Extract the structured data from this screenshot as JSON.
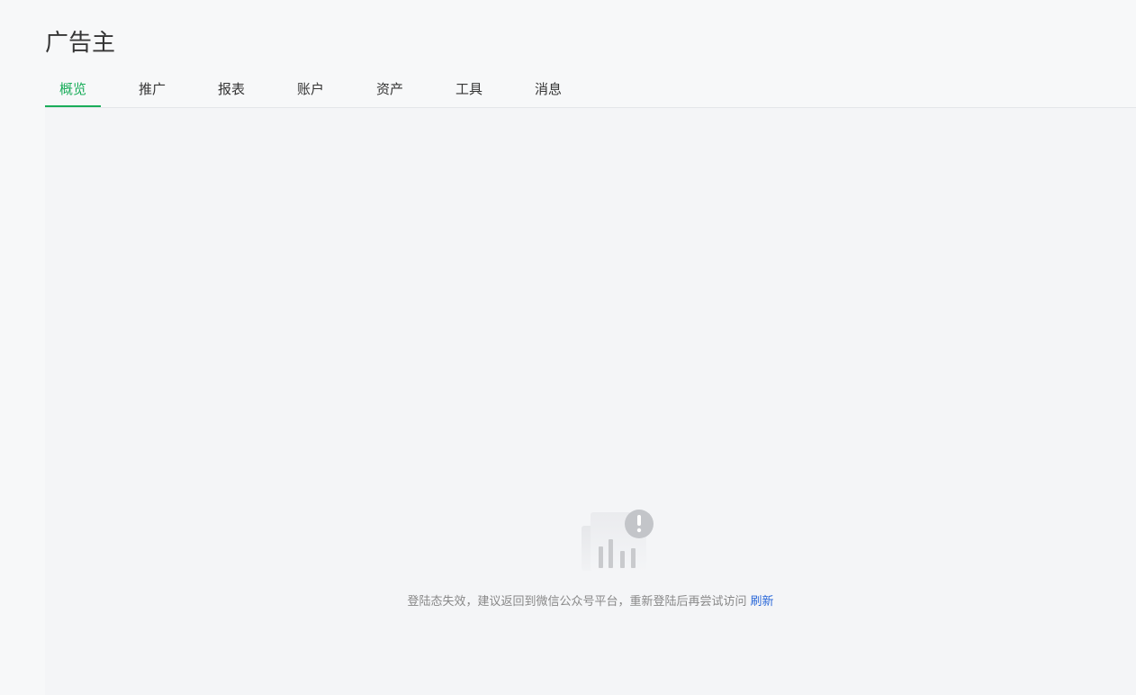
{
  "header": {
    "title": "广告主"
  },
  "tabs": [
    {
      "label": "概览",
      "active": true
    },
    {
      "label": "推广",
      "active": false
    },
    {
      "label": "报表",
      "active": false
    },
    {
      "label": "账户",
      "active": false
    },
    {
      "label": "资产",
      "active": false
    },
    {
      "label": "工具",
      "active": false
    },
    {
      "label": "消息",
      "active": false
    }
  ],
  "empty_state": {
    "icon": "chart-warning-icon",
    "message": "登陆态失效，建议返回到微信公众号平台，重新登陆后再尝试访问",
    "refresh_label": "刷新"
  },
  "colors": {
    "accent": "#1aad5a",
    "link": "#2a68d8",
    "background": "#f4f5f7"
  }
}
